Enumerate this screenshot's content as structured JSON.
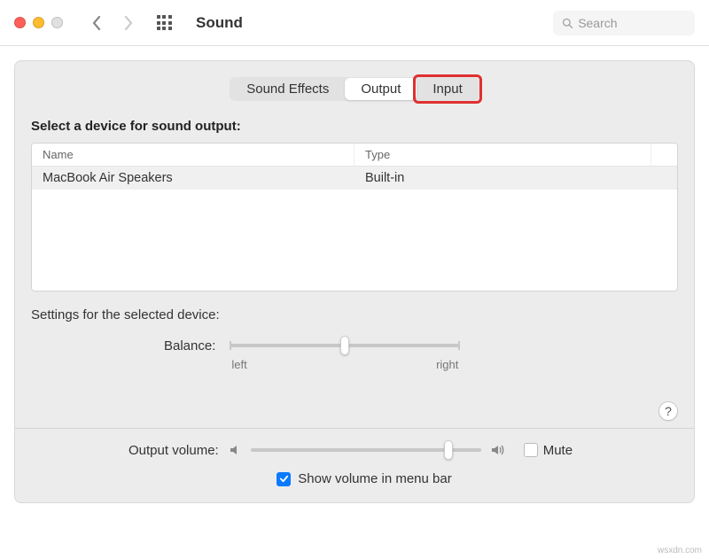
{
  "toolbar": {
    "title": "Sound",
    "search_placeholder": "Search"
  },
  "tabs": {
    "items": [
      {
        "label": "Sound Effects"
      },
      {
        "label": "Output"
      },
      {
        "label": "Input"
      }
    ],
    "active_index": 1,
    "highlighted_index": 2
  },
  "device_section": {
    "heading": "Select a device for sound output:",
    "columns": {
      "name": "Name",
      "type": "Type"
    },
    "rows": [
      {
        "name": "MacBook Air Speakers",
        "type": "Built-in"
      }
    ]
  },
  "settings": {
    "heading": "Settings for the selected device:",
    "balance": {
      "label": "Balance:",
      "left_label": "left",
      "right_label": "right",
      "value_percent": 50
    }
  },
  "footer": {
    "output_volume_label": "Output volume:",
    "output_volume_percent": 86,
    "mute_label": "Mute",
    "mute_checked": false,
    "show_volume_label": "Show volume in menu bar",
    "show_volume_checked": true
  },
  "watermark": "wsxdn.com"
}
